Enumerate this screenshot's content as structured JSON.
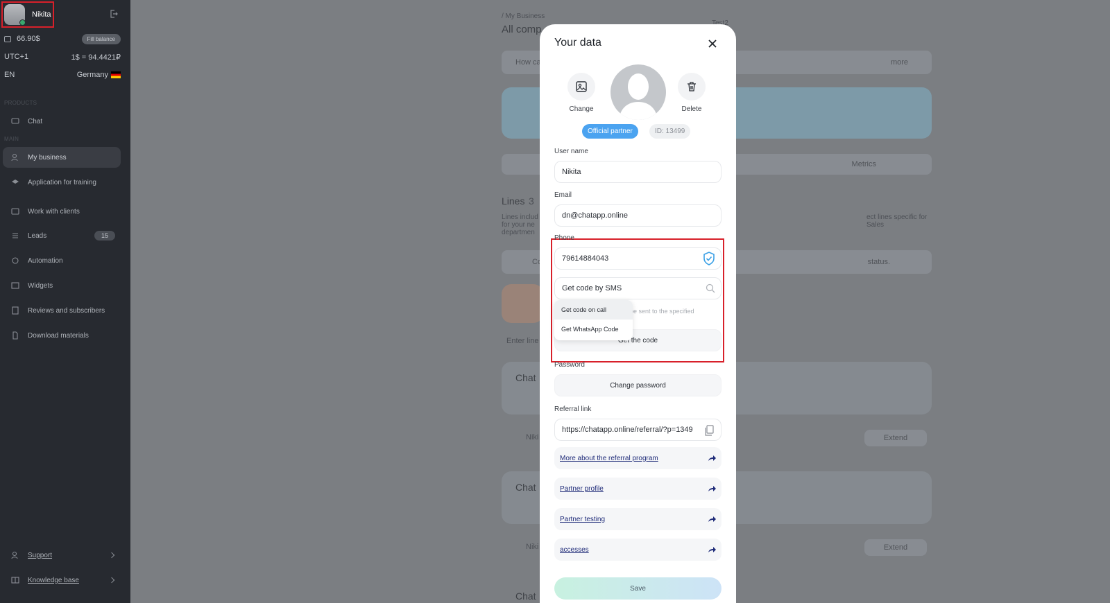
{
  "sidebar": {
    "user_name": "Nikita",
    "balance": "66.90$",
    "fill_balance": "Fill balance",
    "timezone": "UTC+1",
    "rate": "1$ = 94.4421₽",
    "lang": "EN",
    "country": "Germany",
    "section_products": "PRODUCTS",
    "section_main": "MAIN",
    "items": [
      {
        "label": "Chat",
        "icon": "chat-icon"
      },
      {
        "label": "My business",
        "icon": "business-icon"
      },
      {
        "label": "Application for training",
        "icon": "graduation-cap-icon"
      },
      {
        "label": "Work with clients",
        "icon": "clients-icon"
      },
      {
        "label": "Leads",
        "icon": "leads-icon",
        "badge": "15"
      },
      {
        "label": "Automation",
        "icon": "automation-icon"
      },
      {
        "label": "Widgets",
        "icon": "widgets-icon"
      },
      {
        "label": "Reviews and subscribers",
        "icon": "reviews-icon"
      },
      {
        "label": "Download materials",
        "icon": "download-icon"
      }
    ],
    "support": "Support",
    "knowledge_base": "Knowledge base"
  },
  "background": {
    "breadcrumb": "/ My Business",
    "heading": "All comp",
    "tenant": "Test2",
    "banner_text": "How ca",
    "banner_more": "more",
    "metrics": "Metrics",
    "lines_title": "Lines",
    "lines_count": "3",
    "lines_desc_left": "Lines includ for your ne departmen",
    "lines_desc_right": "ect lines specific for Sales",
    "status_text": "status.",
    "co_text": "Co",
    "enter_line": "Enter line",
    "chat_card_1": "Chat",
    "chat_card_2": "Chat",
    "chat_card_3": "Chat",
    "nik_1": "Niki",
    "nik_2": "Niki",
    "extend_1": "Extend",
    "extend_2": "Extend"
  },
  "modal": {
    "title": "Your data",
    "change": "Change",
    "delete": "Delete",
    "partner_badge": "Official partner",
    "id_badge": "ID: 13499",
    "username_label": "User name",
    "username": "Nikita",
    "email_label": "Email",
    "email": "dn@chatapp.online",
    "phone_label": "Phone",
    "phone": "79614884043",
    "sms_select": "Get code by SMS",
    "dropdown_options": [
      "Get code on call",
      "Get WhatsApp Code"
    ],
    "hint": "be sent to the specified",
    "get_code": "Get the code",
    "password_label": "Password",
    "change_password": "Change password",
    "referral_label": "Referral link",
    "referral_link": "https://chatapp.online/referral/?p=1349",
    "links": [
      "More about the referral program",
      "Partner profile",
      "Partner testing",
      "accesses"
    ],
    "save": "Save"
  }
}
